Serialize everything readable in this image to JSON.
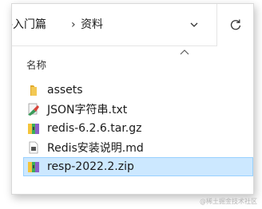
{
  "breadcrumb": {
    "parent": "-入门篇",
    "current": "资料"
  },
  "column_header": "名称",
  "files": [
    {
      "name": "assets",
      "icon": "folder-icon"
    },
    {
      "name": "JSON字符串.txt",
      "icon": "txt-file-icon"
    },
    {
      "name": "redis-6.2.6.tar.gz",
      "icon": "archive-icon"
    },
    {
      "name": "Redis安装说明.md",
      "icon": "md-file-icon"
    },
    {
      "name": "resp-2022.2.zip",
      "icon": "archive-icon",
      "selected": true
    }
  ],
  "watermark": "@稀土掘金技术社区",
  "colors": {
    "selection_bg": "#cce8ff",
    "selection_border": "#99d1ff",
    "folder": "#f1c54a"
  }
}
